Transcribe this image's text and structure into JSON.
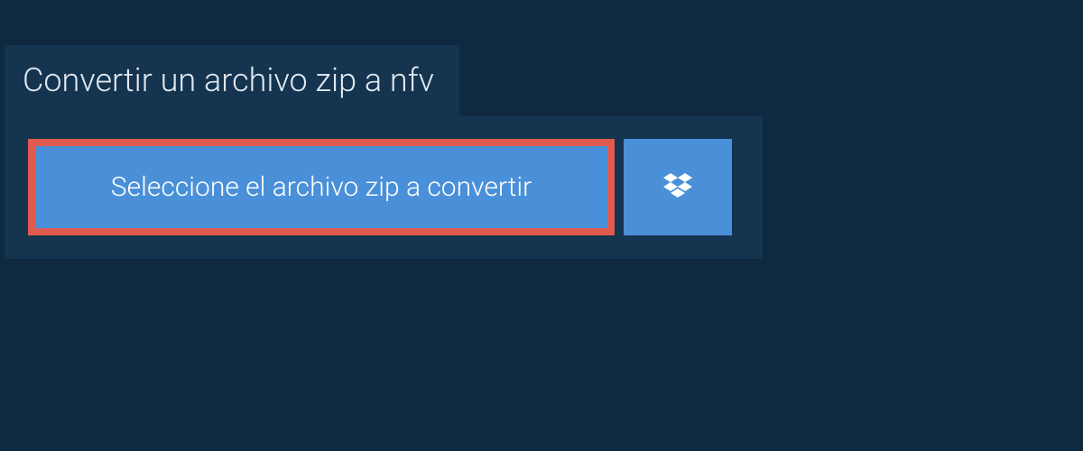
{
  "tab": {
    "title": "Convertir un archivo zip a nfv"
  },
  "actions": {
    "select_file_label": "Seleccione el archivo zip a convertir"
  },
  "colors": {
    "background": "#0f2940",
    "panel": "#14344f",
    "button": "#4a90d9",
    "highlight_border": "#e05a4f"
  }
}
